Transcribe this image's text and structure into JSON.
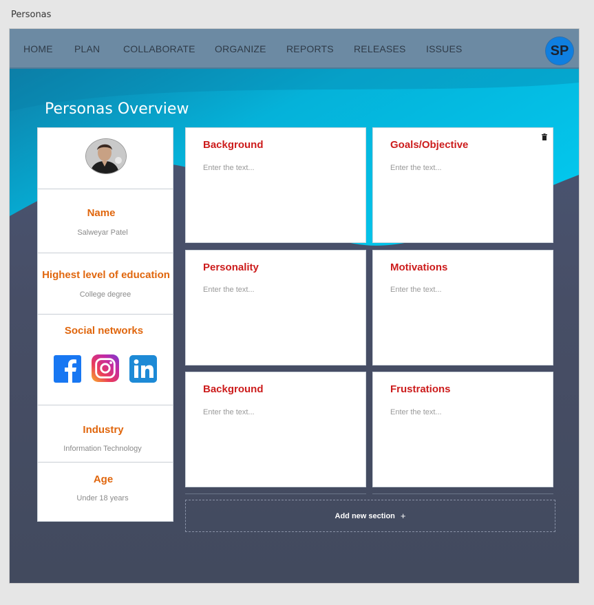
{
  "window": {
    "title": "Personas"
  },
  "nav": {
    "items": [
      {
        "label": "HOME"
      },
      {
        "label": "PLAN"
      },
      {
        "label": "COLLABORATE"
      },
      {
        "label": "ORGANIZE"
      },
      {
        "label": "REPORTS"
      },
      {
        "label": "RELEASES"
      },
      {
        "label": "ISSUES"
      }
    ],
    "user_initials": "SP"
  },
  "page": {
    "title": "Personas Overview"
  },
  "profile": {
    "name_label": "Name",
    "name_value": "Salweyar Patel",
    "education_label": "Highest level of education",
    "education_value": "College degree",
    "social_label": "Social networks",
    "social_icons": [
      "facebook-icon",
      "instagram-icon",
      "linkedin-icon"
    ],
    "industry_label": "Industry",
    "industry_value": "Information Technology",
    "age_label": "Age",
    "age_value": "Under 18 years"
  },
  "sections": [
    {
      "title": "Background",
      "placeholder": "Enter the text..."
    },
    {
      "title": "Goals/Objective",
      "placeholder": "Enter the text..."
    },
    {
      "title": "Personality",
      "placeholder": "Enter the text..."
    },
    {
      "title": "Motivations",
      "placeholder": "Enter the text..."
    },
    {
      "title": "Background",
      "placeholder": "Enter the text..."
    },
    {
      "title": "Frustrations",
      "placeholder": "Enter the text..."
    }
  ],
  "add_section": {
    "label": "Add new section",
    "plus": "+"
  },
  "colors": {
    "accent_orange": "#e0660d",
    "section_title_red": "#cc1c1c",
    "nav_bg": "#6c8aa3",
    "hero_cyan": "#04c3e8",
    "avatar_blue": "#0f7fe0"
  }
}
